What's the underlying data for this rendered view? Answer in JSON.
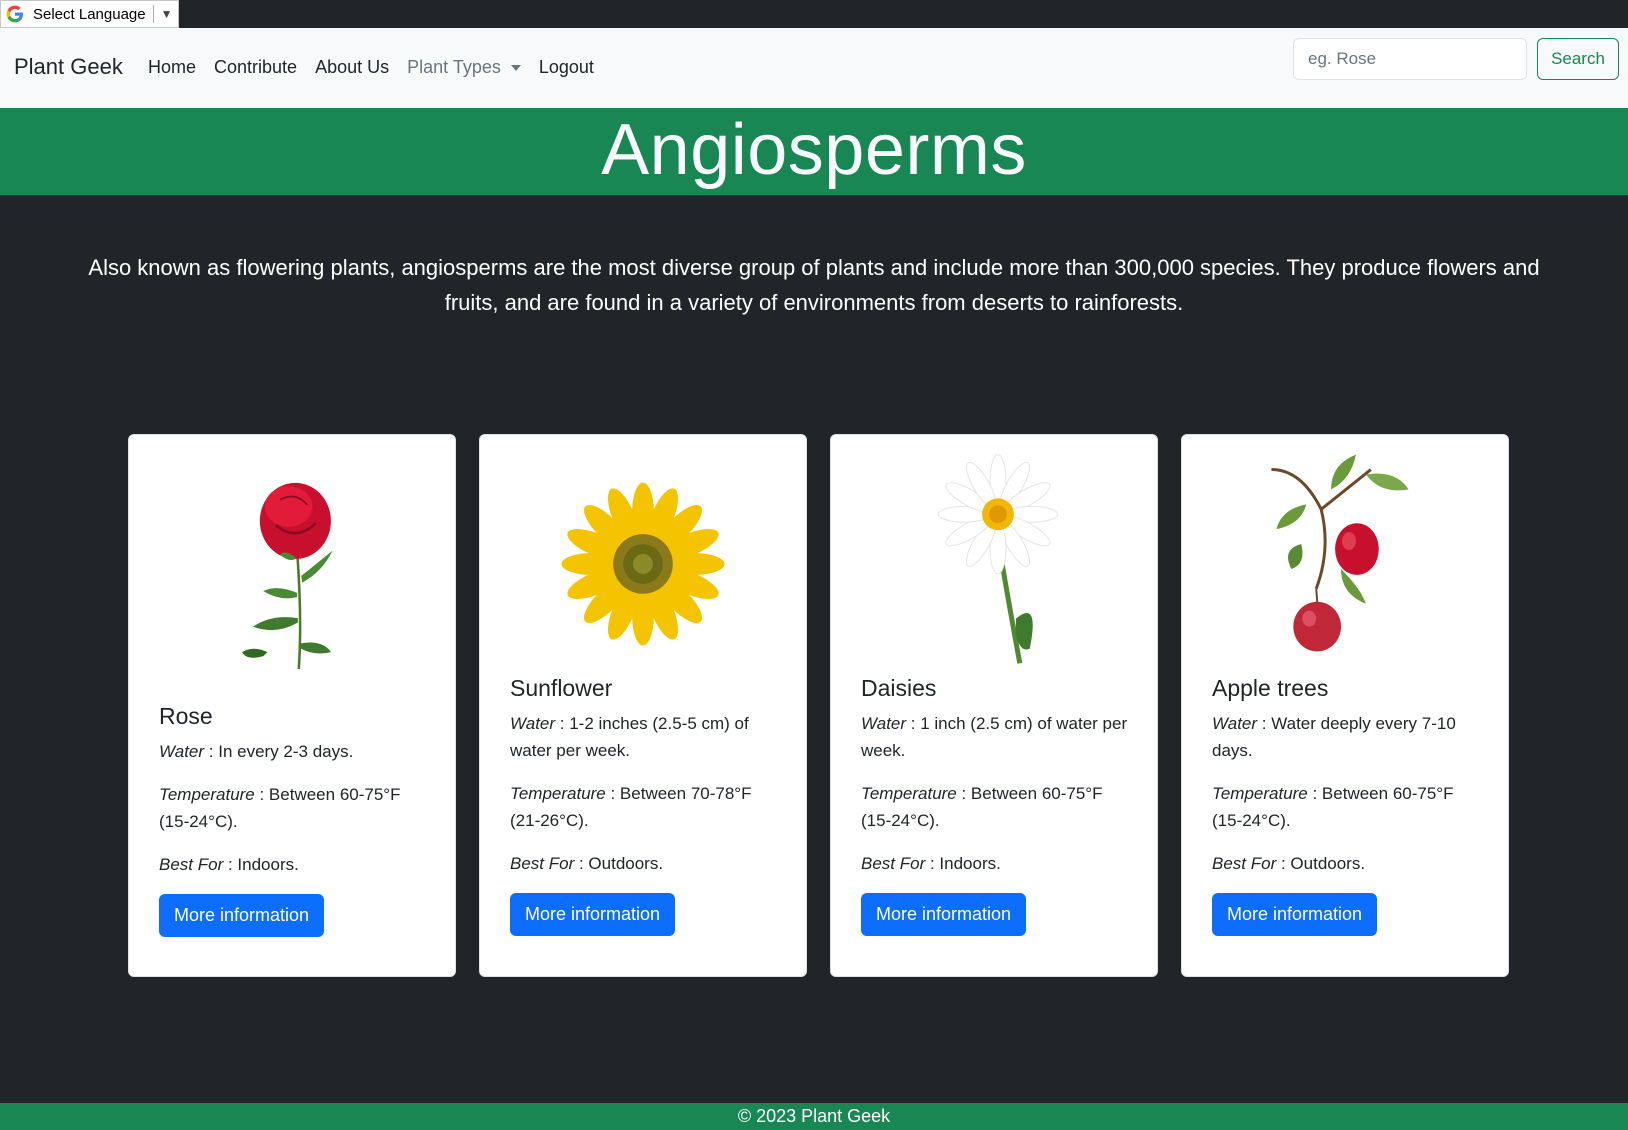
{
  "translate": {
    "label": "Select Language"
  },
  "navbar": {
    "brand": "Plant Geek",
    "links": [
      "Home",
      "Contribute",
      "About Us"
    ],
    "dropdown": "Plant Types",
    "logout": "Logout",
    "search_placeholder": "eg. Rose",
    "search_button": "Search"
  },
  "hero": {
    "title": "Angiosperms"
  },
  "intro": "Also known as flowering plants, angiosperms are the most diverse group of plants and include more than 300,000 species. They produce flowers and fruits, and are found in a variety of environments from deserts to rainforests.",
  "labels": {
    "water": "Water",
    "temperature": "Temperature",
    "best_for": "Best For",
    "more": "More information"
  },
  "cards": [
    {
      "title": "Rose",
      "water": " : In every 2-3 days.",
      "temperature": " : Between 60-75°F (15-24°C).",
      "best_for": " : Indoors."
    },
    {
      "title": "Sunflower",
      "water": " : 1-2 inches (2.5-5 cm) of water per week.",
      "temperature": " : Between 70-78°F (21-26°C).",
      "best_for": " : Outdoors."
    },
    {
      "title": "Daisies",
      "water": " : 1 inch (2.5 cm) of water per week.",
      "temperature": " : Between 60-75°F (15-24°C).",
      "best_for": " : Indoors."
    },
    {
      "title": "Apple trees",
      "water": " : Water deeply every 7-10 days.",
      "temperature": " : Between 60-75°F (15-24°C).",
      "best_for": " : Outdoors."
    }
  ],
  "footer": "© 2023 Plant Geek",
  "colors": {
    "primary_green": "#198754",
    "dark_bg": "#212529",
    "blue_button": "#0d6efd"
  }
}
